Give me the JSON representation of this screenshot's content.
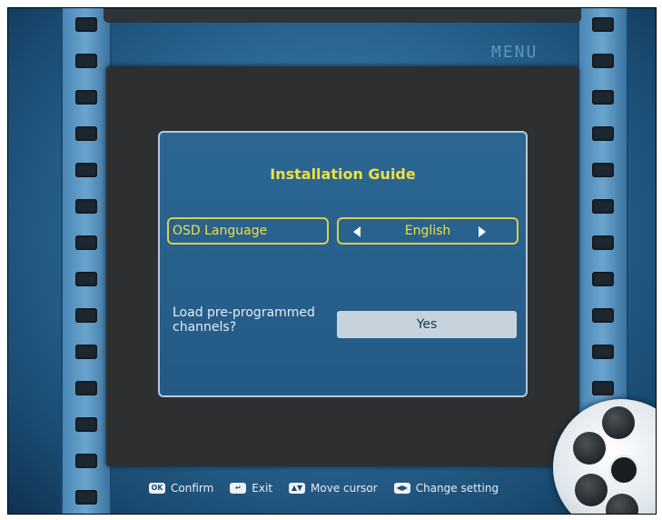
{
  "menu_label": "MENU",
  "dialog": {
    "title": "Installation Guide",
    "osd_language_label": "OSD Language",
    "osd_language_value": "English",
    "load_channels_label_line1": "Load pre-programmed",
    "load_channels_label_line2": "channels?",
    "load_channels_value": "Yes"
  },
  "footer": {
    "hints": [
      {
        "key": "OK",
        "label": "Confirm"
      },
      {
        "key": "↵",
        "label": "Exit"
      },
      {
        "key": "▲▼",
        "label": "Move cursor"
      },
      {
        "key": "◀▶",
        "label": "Change setting"
      }
    ]
  },
  "colors": {
    "title_yellow": "#f0e040",
    "focus_border": "#d8cf4a",
    "dialog_blue": "#2c6793",
    "button_gray": "#c7d3dc"
  },
  "icons": [
    "film-strip-left",
    "film-strip-right",
    "film-reel-icon",
    "arrow-left-icon",
    "arrow-right-icon"
  ]
}
